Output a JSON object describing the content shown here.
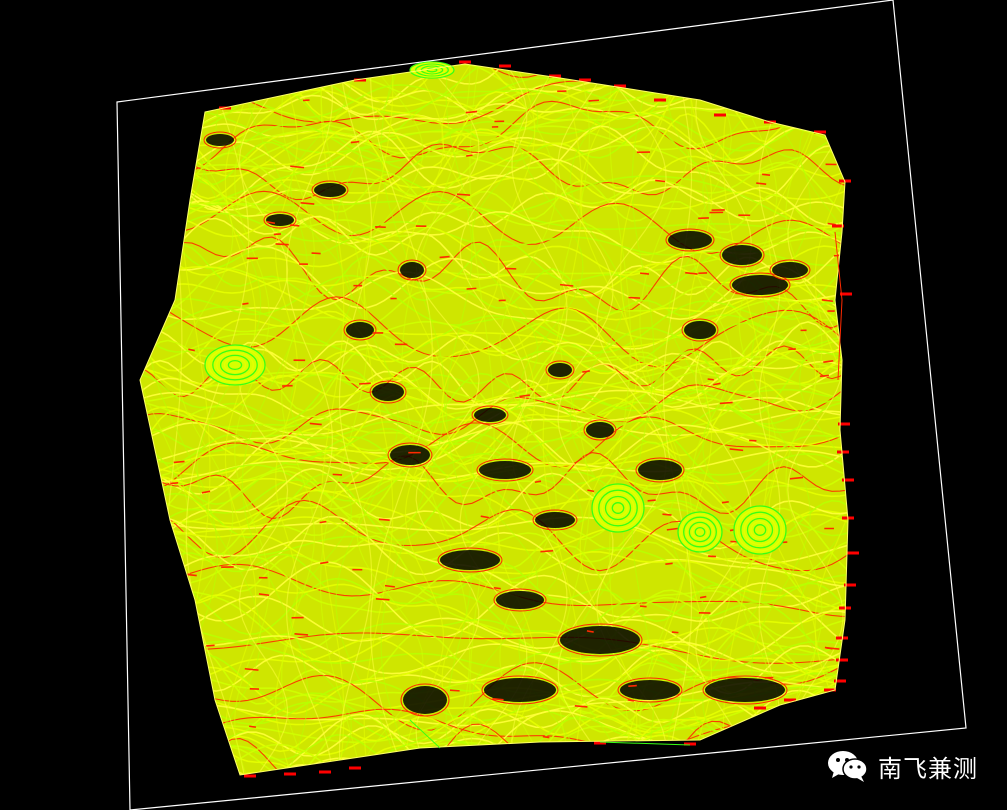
{
  "viewport": {
    "background": "#000000",
    "frame_color": "#ffffff",
    "contour_colors": [
      "#e6ff00",
      "#cfff00",
      "#ffff3a",
      "#b8ff00"
    ],
    "index_contour_color": "#ff2a00",
    "closed_contour_color": "#39ff14",
    "boundary_marker_color": "#ff0000"
  },
  "watermark": {
    "icon": "wechat-icon",
    "text": "南飞兼测"
  }
}
